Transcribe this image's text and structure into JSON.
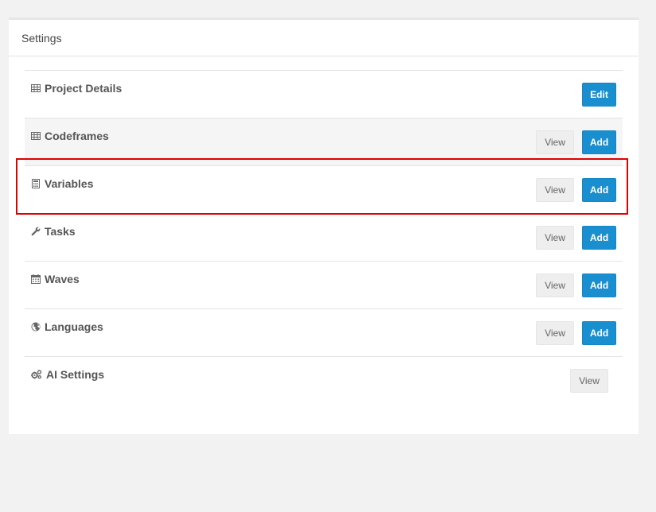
{
  "panel": {
    "title": "Settings"
  },
  "rows": [
    {
      "label": "Project Details",
      "icon": "table-icon",
      "edit_label": "Edit"
    },
    {
      "label": "Codeframes",
      "icon": "table-icon",
      "view_label": "View",
      "add_label": "Add"
    },
    {
      "label": "Variables",
      "icon": "calculator-icon",
      "view_label": "View",
      "add_label": "Add"
    },
    {
      "label": "Tasks",
      "icon": "wrench-icon",
      "view_label": "View",
      "add_label": "Add"
    },
    {
      "label": "Waves",
      "icon": "calendar-icon",
      "view_label": "View",
      "add_label": "Add"
    },
    {
      "label": "Languages",
      "icon": "globe-icon",
      "view_label": "View",
      "add_label": "Add"
    },
    {
      "label": "AI Settings",
      "icon": "cogs-icon",
      "view_label": "View"
    }
  ],
  "colors": {
    "primary_button": "#1a8fd0",
    "highlight_border": "#e00000",
    "page_background": "#f2f2f2"
  }
}
